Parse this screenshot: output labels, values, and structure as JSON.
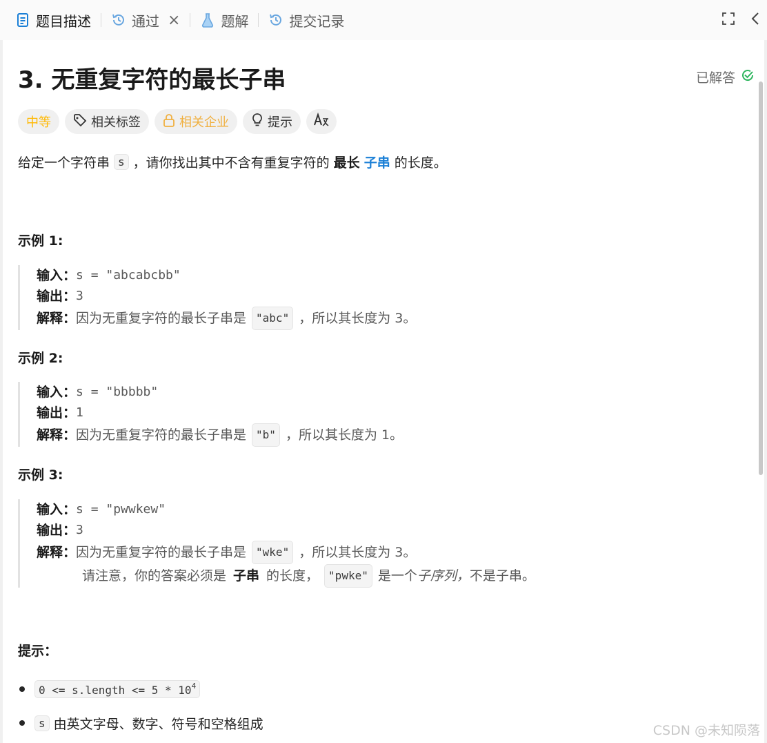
{
  "tabs": [
    {
      "label": "题目描述",
      "icon": "document-icon",
      "active": true
    },
    {
      "label": "通过",
      "icon": "history-icon",
      "closable": true
    },
    {
      "label": "题解",
      "icon": "flask-icon"
    },
    {
      "label": "提交记录",
      "icon": "history-icon"
    }
  ],
  "problem": {
    "title": "3. 无重复字符的最长子串",
    "status": "已解答",
    "tags": {
      "difficulty": "中等",
      "related_tags": "相关标签",
      "related_companies": "相关企业",
      "hint": "提示"
    },
    "description": {
      "before": "给定一个字符串",
      "var": "s",
      "middle": "，请你找出其中不含有重复字符的",
      "strong": "最长",
      "link": "子串",
      "after": "的长度。"
    }
  },
  "labels": {
    "input": "输入：",
    "output": "输出：",
    "explain": "解释："
  },
  "examples": [
    {
      "title": "示例 1:",
      "input": "s = \"abcabcbb\"",
      "output": "3",
      "exp_before": "因为无重复字符的最长子串是",
      "exp_code": "\"abc\"",
      "exp_after": "，所以其长度为 3。"
    },
    {
      "title": "示例 2:",
      "input": "s = \"bbbbb\"",
      "output": "1",
      "exp_before": "因为无重复字符的最长子串是",
      "exp_code": "\"b\"",
      "exp_after": "，所以其长度为 1。"
    },
    {
      "title": "示例 3:",
      "input": "s = \"pwwkew\"",
      "output": "3",
      "exp_before": "因为无重复字符的最长子串是",
      "exp_code": "\"wke\"",
      "exp_after": "，所以其长度为 3。",
      "note": {
        "before": "请注意，你的答案必须是",
        "strong": "子串",
        "middle": "的长度，",
        "code": "\"pwke\"",
        "mid2": "是一个",
        "italic": "子序列，",
        "after": "不是子串。"
      }
    }
  ],
  "hints": {
    "title": "提示：",
    "c1_code": "0 <= s.length <= 5 * 10",
    "c1_sup": "4",
    "c2_code": "s",
    "c2_text": "由英文字母、数字、符号和空格组成"
  },
  "watermark": "CSDN @未知陨落",
  "colors": {
    "accent_blue": "#1a7fd6",
    "difficulty_medium": "#ffb800",
    "solved_green": "#2db55d"
  }
}
